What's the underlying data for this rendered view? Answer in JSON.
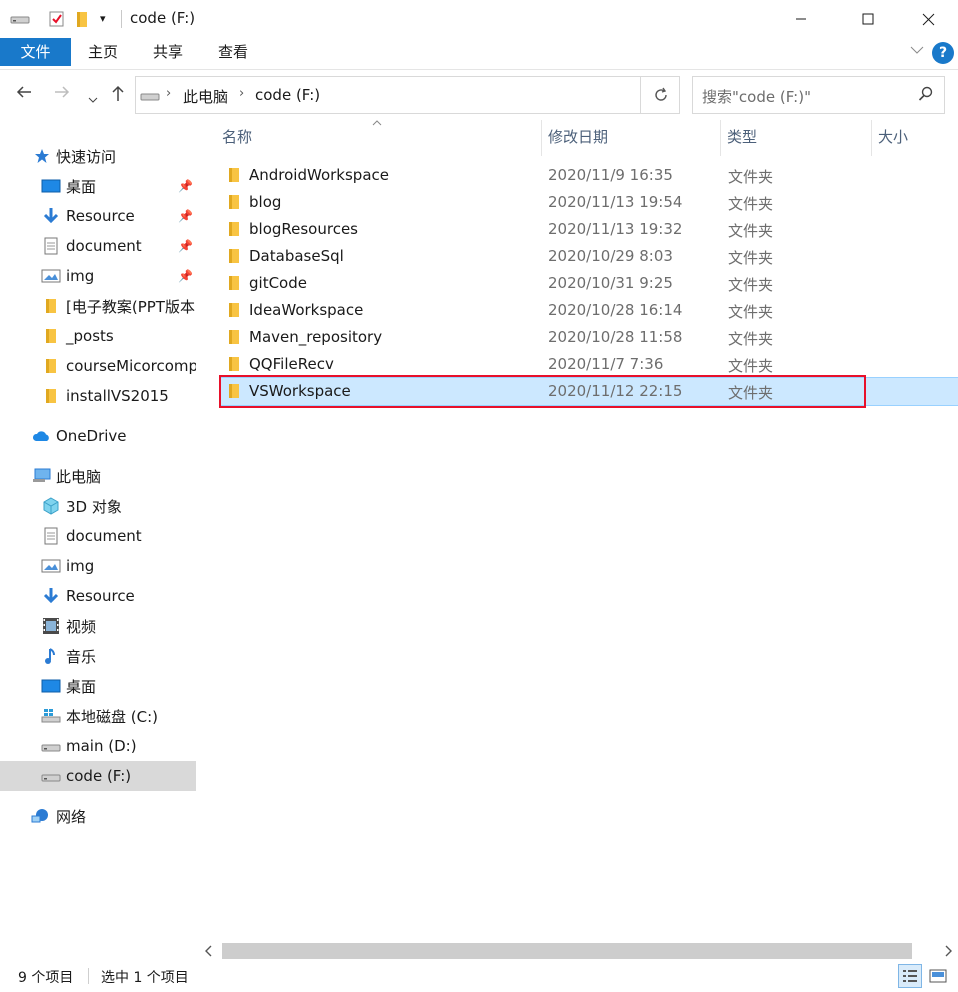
{
  "window": {
    "title": "code (F:)"
  },
  "ribbon": {
    "tabs": [
      "文件",
      "主页",
      "共享",
      "查看"
    ],
    "help_label": "?"
  },
  "address": {
    "crumbs": [
      "此电脑",
      "code (F:)"
    ],
    "search_placeholder": "搜索\"code (F:)\""
  },
  "nav": {
    "quick_access": "快速访问",
    "pinned": [
      {
        "label": "桌面",
        "icon": "desktop-icon"
      },
      {
        "label": "Resource",
        "icon": "download-arrow-icon"
      },
      {
        "label": "document",
        "icon": "document-icon"
      },
      {
        "label": "img",
        "icon": "image-icon"
      }
    ],
    "recent": [
      "[电子教案(PPT版本)]",
      "_posts",
      "courseMicorcomp",
      "installVS2015"
    ],
    "onedrive": "OneDrive",
    "this_pc": "此电脑",
    "pc_items": [
      {
        "label": "3D 对象",
        "icon": "3d-objects-icon"
      },
      {
        "label": "document",
        "icon": "document-icon"
      },
      {
        "label": "img",
        "icon": "image-icon"
      },
      {
        "label": "Resource",
        "icon": "download-arrow-icon"
      },
      {
        "label": "视频",
        "icon": "video-icon"
      },
      {
        "label": "音乐",
        "icon": "music-icon"
      },
      {
        "label": "桌面",
        "icon": "desktop-icon"
      },
      {
        "label": "本地磁盘 (C:)",
        "icon": "windows-drive-icon"
      },
      {
        "label": "main (D:)",
        "icon": "drive-icon"
      },
      {
        "label": "code (F:)",
        "icon": "drive-icon"
      }
    ],
    "network": "网络"
  },
  "columns": {
    "name": "名称",
    "date": "修改日期",
    "type": "类型",
    "size": "大小"
  },
  "files": [
    {
      "name": "AndroidWorkspace",
      "date": "2020/11/9 16:35",
      "type": "文件夹"
    },
    {
      "name": "blog",
      "date": "2020/11/13 19:54",
      "type": "文件夹"
    },
    {
      "name": "blogResources",
      "date": "2020/11/13 19:32",
      "type": "文件夹"
    },
    {
      "name": "DatabaseSql",
      "date": "2020/10/29 8:03",
      "type": "文件夹"
    },
    {
      "name": "gitCode",
      "date": "2020/10/31 9:25",
      "type": "文件夹"
    },
    {
      "name": "IdeaWorkspace",
      "date": "2020/10/28 16:14",
      "type": "文件夹"
    },
    {
      "name": "Maven_repository",
      "date": "2020/10/28 11:58",
      "type": "文件夹"
    },
    {
      "name": "QQFileRecv",
      "date": "2020/11/7 7:36",
      "type": "文件夹"
    },
    {
      "name": "VSWorkspace",
      "date": "2020/11/12 22:15",
      "type": "文件夹"
    }
  ],
  "status": {
    "count": "9 个项目",
    "selected": "选中 1 个项目"
  },
  "colors": {
    "accent": "#1979ca",
    "selection": "#cce8ff",
    "highlight": "#e8102a",
    "folder": "#f8c443"
  }
}
